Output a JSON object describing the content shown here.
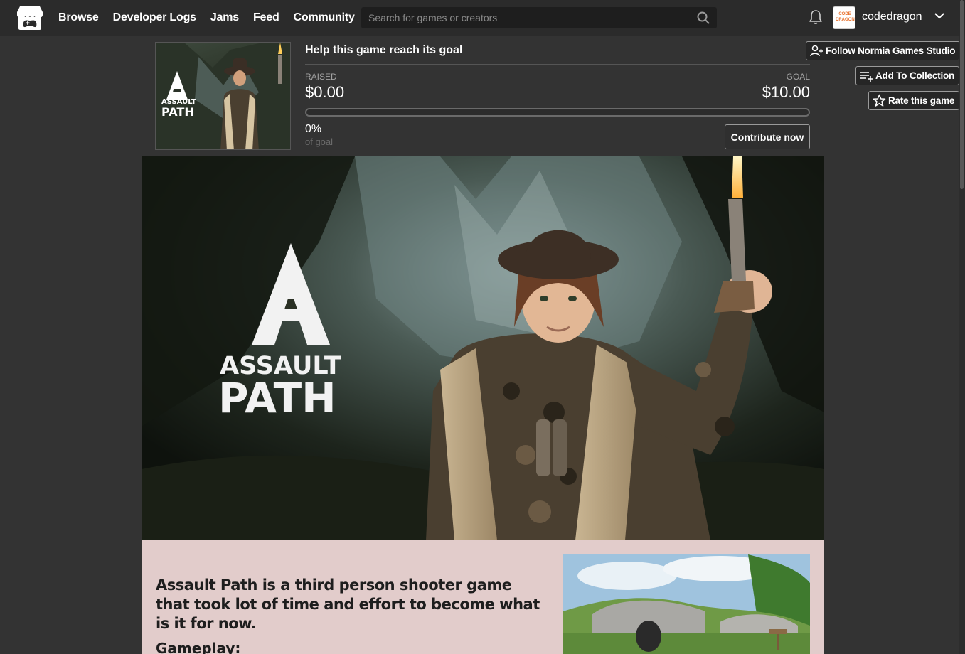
{
  "nav": {
    "links": [
      "Browse",
      "Developer Logs",
      "Jams",
      "Feed",
      "Community"
    ],
    "search_placeholder": "Search for games or creators",
    "username": "codedragon",
    "avatar_text": "CODE DRAGON"
  },
  "goal": {
    "title": "Help this game reach its goal",
    "raised_label": "RAISED",
    "raised_value": "$0.00",
    "goal_label": "GOAL",
    "goal_value": "$10.00",
    "progress_fraction": 0,
    "percent_text": "0%",
    "of_goal_text": "of goal",
    "contribute_label": "Contribute now"
  },
  "actions": {
    "follow_label": "Follow Normia Games Studio",
    "collection_label": "Add To Collection",
    "rate_label": "Rate this game"
  },
  "game": {
    "logo_line1": "ASSAULT",
    "logo_line2": "PATH",
    "description": "Assault Path is a third person shooter game that took lot of time and effort to become what is it for now.",
    "section_heading": "Gameplay:"
  },
  "colors": {
    "nav_bg": "#2b2b2b",
    "page_bg": "#333333",
    "content_bg": "#e2cccb",
    "accent": "#fa5c5c"
  }
}
